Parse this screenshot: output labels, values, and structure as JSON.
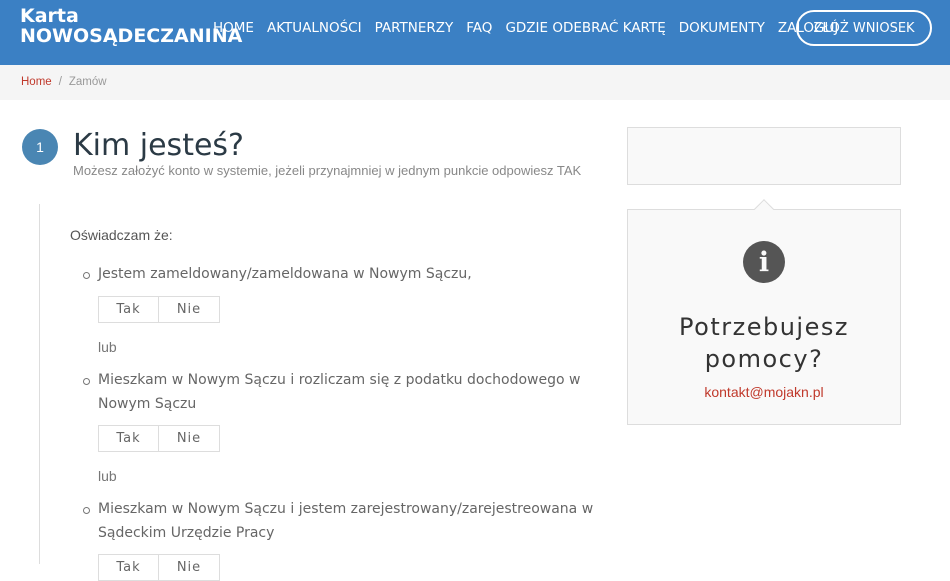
{
  "header": {
    "logo_line1": "Karta",
    "logo_line2": "NOWOSĄDECZANINA",
    "nav": [
      "HOME",
      "AKTUALNOŚCI",
      "PARTNERZY",
      "FAQ",
      "GDZIE ODEBRAĆ KARTĘ",
      "DOKUMENTY",
      "ZALOGUJ"
    ],
    "apply_label": "ZŁÓŻ WNIOSEK"
  },
  "breadcrumb": {
    "home": "Home",
    "separator": "/",
    "current": "Zamów"
  },
  "step": {
    "number": "1",
    "title": "Kim jesteś?",
    "subtitle": "Możesz założyć konto w systemie, jeżeli przynajmniej w jednym punkcie odpowiesz TAK"
  },
  "form": {
    "intro": "Oświadczam że:",
    "items": [
      "Jestem zameldowany/zameldowana w Nowym Sączu,",
      "Mieszkam w Nowym Sączu i rozliczam się z podatku dochodowego w Nowym Sączu",
      "Mieszkam w Nowym Sączu i jestem zarejestrowany/zarejestreowana w Sądeckim Urzędzie Pracy"
    ],
    "yes": "Tak",
    "no": "Nie",
    "or": "lub"
  },
  "sidebar": {
    "help_title": "Potrzebujesz pomocy?",
    "email": "kontakt@mojakn.pl",
    "info_icon": "i"
  },
  "colors": {
    "header": "#3b80c4",
    "accent": "#c0392b",
    "step": "#4a86b3"
  }
}
